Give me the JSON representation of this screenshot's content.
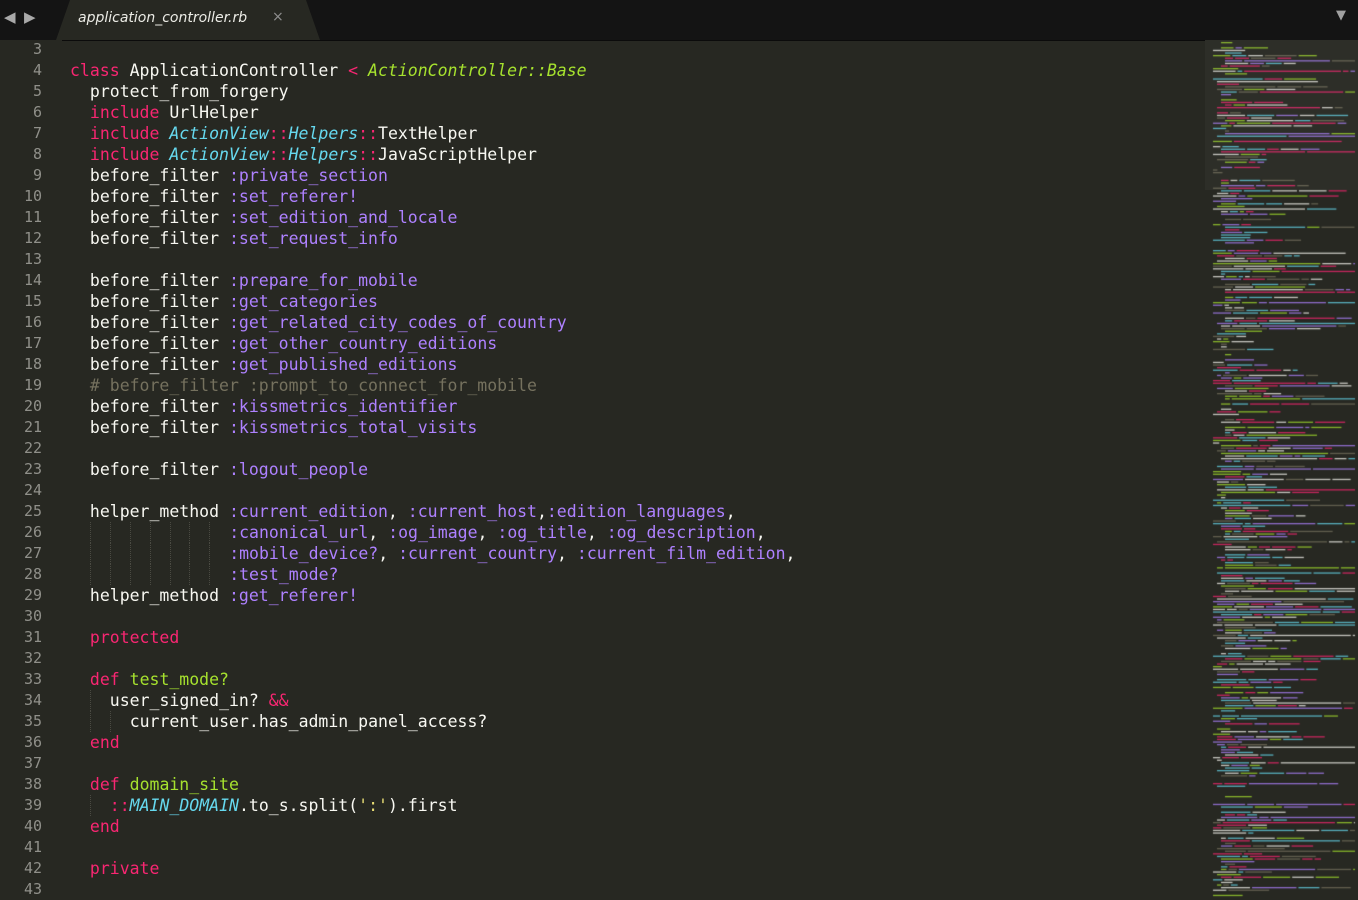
{
  "tab": {
    "title": "application_controller.rb",
    "close_glyph": "×"
  },
  "nav": {
    "back_glyph": "◀",
    "forward_glyph": "▶",
    "dropdown_glyph": "▼"
  },
  "colors": {
    "background": "#272822",
    "keyword": "#f92672",
    "symbol": "#ae81ff",
    "function": "#a6e22e",
    "namespace": "#66d9ef",
    "comment": "#75715e",
    "text": "#f8f8f2"
  },
  "lines": [
    {
      "n": "3",
      "indent": 0,
      "tokens": []
    },
    {
      "n": "4",
      "indent": 0,
      "tokens": [
        [
          "kw",
          "class"
        ],
        [
          "txt",
          " ApplicationController "
        ],
        [
          "op",
          "<"
        ],
        [
          "txt",
          " "
        ],
        [
          "inh",
          "ActionController::Base"
        ]
      ]
    },
    {
      "n": "5",
      "indent": 1,
      "tokens": [
        [
          "txt",
          "protect_from_forgery"
        ]
      ]
    },
    {
      "n": "6",
      "indent": 1,
      "tokens": [
        [
          "kw",
          "include"
        ],
        [
          "txt",
          " UrlHelper"
        ]
      ]
    },
    {
      "n": "7",
      "indent": 1,
      "tokens": [
        [
          "kw",
          "include"
        ],
        [
          "txt",
          " "
        ],
        [
          "ns",
          "ActionView"
        ],
        [
          "op",
          "::"
        ],
        [
          "ns",
          "Helpers"
        ],
        [
          "op",
          "::"
        ],
        [
          "txt",
          "TextHelper"
        ]
      ]
    },
    {
      "n": "8",
      "indent": 1,
      "tokens": [
        [
          "kw",
          "include"
        ],
        [
          "txt",
          " "
        ],
        [
          "ns",
          "ActionView"
        ],
        [
          "op",
          "::"
        ],
        [
          "ns",
          "Helpers"
        ],
        [
          "op",
          "::"
        ],
        [
          "txt",
          "JavaScriptHelper"
        ]
      ]
    },
    {
      "n": "9",
      "indent": 1,
      "tokens": [
        [
          "txt",
          "before_filter "
        ],
        [
          "sym",
          ":private_section"
        ]
      ]
    },
    {
      "n": "10",
      "indent": 1,
      "tokens": [
        [
          "txt",
          "before_filter "
        ],
        [
          "sym",
          ":set_referer!"
        ]
      ]
    },
    {
      "n": "11",
      "indent": 1,
      "tokens": [
        [
          "txt",
          "before_filter "
        ],
        [
          "sym",
          ":set_edition_and_locale"
        ]
      ]
    },
    {
      "n": "12",
      "indent": 1,
      "tokens": [
        [
          "txt",
          "before_filter "
        ],
        [
          "sym",
          ":set_request_info"
        ]
      ]
    },
    {
      "n": "13",
      "indent": 0,
      "tokens": []
    },
    {
      "n": "14",
      "indent": 1,
      "tokens": [
        [
          "txt",
          "before_filter "
        ],
        [
          "sym",
          ":prepare_for_mobile"
        ]
      ]
    },
    {
      "n": "15",
      "indent": 1,
      "tokens": [
        [
          "txt",
          "before_filter "
        ],
        [
          "sym",
          ":get_categories"
        ]
      ]
    },
    {
      "n": "16",
      "indent": 1,
      "tokens": [
        [
          "txt",
          "before_filter "
        ],
        [
          "sym",
          ":get_related_city_codes_of_country"
        ]
      ]
    },
    {
      "n": "17",
      "indent": 1,
      "tokens": [
        [
          "txt",
          "before_filter "
        ],
        [
          "sym",
          ":get_other_country_editions"
        ]
      ]
    },
    {
      "n": "18",
      "indent": 1,
      "tokens": [
        [
          "txt",
          "before_filter "
        ],
        [
          "sym",
          ":get_published_editions"
        ]
      ]
    },
    {
      "n": "19",
      "indent": 1,
      "tokens": [
        [
          "cmt",
          "# before_filter :prompt_to_connect_for_mobile"
        ]
      ]
    },
    {
      "n": "20",
      "indent": 1,
      "tokens": [
        [
          "txt",
          "before_filter "
        ],
        [
          "sym",
          ":kissmetrics_identifier"
        ]
      ]
    },
    {
      "n": "21",
      "indent": 1,
      "tokens": [
        [
          "txt",
          "before_filter "
        ],
        [
          "sym",
          ":kissmetrics_total_visits"
        ]
      ]
    },
    {
      "n": "22",
      "indent": 0,
      "tokens": []
    },
    {
      "n": "23",
      "indent": 1,
      "tokens": [
        [
          "txt",
          "before_filter "
        ],
        [
          "sym",
          ":logout_people"
        ]
      ]
    },
    {
      "n": "24",
      "indent": 0,
      "tokens": []
    },
    {
      "n": "25",
      "indent": 1,
      "tokens": [
        [
          "txt",
          "helper_method "
        ],
        [
          "sym",
          ":current_edition"
        ],
        [
          "txt",
          ", "
        ],
        [
          "sym",
          ":current_host"
        ],
        [
          "txt",
          ","
        ],
        [
          "sym",
          ":edition_languages"
        ],
        [
          "txt",
          ","
        ]
      ]
    },
    {
      "n": "26",
      "indent": 8,
      "tokens": [
        [
          "sym",
          ":canonical_url"
        ],
        [
          "txt",
          ", "
        ],
        [
          "sym",
          ":og_image"
        ],
        [
          "txt",
          ", "
        ],
        [
          "sym",
          ":og_title"
        ],
        [
          "txt",
          ", "
        ],
        [
          "sym",
          ":og_description"
        ],
        [
          "txt",
          ","
        ]
      ]
    },
    {
      "n": "27",
      "indent": 8,
      "tokens": [
        [
          "sym",
          ":mobile_device?"
        ],
        [
          "txt",
          ", "
        ],
        [
          "sym",
          ":current_country"
        ],
        [
          "txt",
          ", "
        ],
        [
          "sym",
          ":current_film_edition"
        ],
        [
          "txt",
          ","
        ]
      ]
    },
    {
      "n": "28",
      "indent": 8,
      "tokens": [
        [
          "sym",
          ":test_mode?"
        ]
      ]
    },
    {
      "n": "29",
      "indent": 1,
      "tokens": [
        [
          "txt",
          "helper_method "
        ],
        [
          "sym",
          ":get_referer!"
        ]
      ]
    },
    {
      "n": "30",
      "indent": 0,
      "tokens": []
    },
    {
      "n": "31",
      "indent": 1,
      "tokens": [
        [
          "kw",
          "protected"
        ]
      ]
    },
    {
      "n": "32",
      "indent": 0,
      "tokens": []
    },
    {
      "n": "33",
      "indent": 1,
      "tokens": [
        [
          "kw",
          "def"
        ],
        [
          "txt",
          " "
        ],
        [
          "fn",
          "test_mode?"
        ]
      ]
    },
    {
      "n": "34",
      "indent": 2,
      "tokens": [
        [
          "txt",
          "user_signed_in? "
        ],
        [
          "op",
          "&&"
        ]
      ]
    },
    {
      "n": "35",
      "indent": 3,
      "tokens": [
        [
          "txt",
          "current_user.has_admin_panel_access?"
        ]
      ]
    },
    {
      "n": "36",
      "indent": 1,
      "tokens": [
        [
          "kw",
          "end"
        ]
      ]
    },
    {
      "n": "37",
      "indent": 0,
      "tokens": []
    },
    {
      "n": "38",
      "indent": 1,
      "tokens": [
        [
          "kw",
          "def"
        ],
        [
          "txt",
          " "
        ],
        [
          "fn",
          "domain_site"
        ]
      ]
    },
    {
      "n": "39",
      "indent": 2,
      "tokens": [
        [
          "op",
          "::"
        ],
        [
          "ns",
          "MAIN_DOMAIN"
        ],
        [
          "txt",
          ".to_s.split("
        ],
        [
          "str",
          "':'"
        ],
        [
          "txt",
          ").first"
        ]
      ]
    },
    {
      "n": "40",
      "indent": 1,
      "tokens": [
        [
          "kw",
          "end"
        ]
      ]
    },
    {
      "n": "41",
      "indent": 0,
      "tokens": []
    },
    {
      "n": "42",
      "indent": 1,
      "tokens": [
        [
          "kw",
          "private"
        ]
      ]
    },
    {
      "n": "43",
      "indent": 0,
      "tokens": []
    }
  ]
}
